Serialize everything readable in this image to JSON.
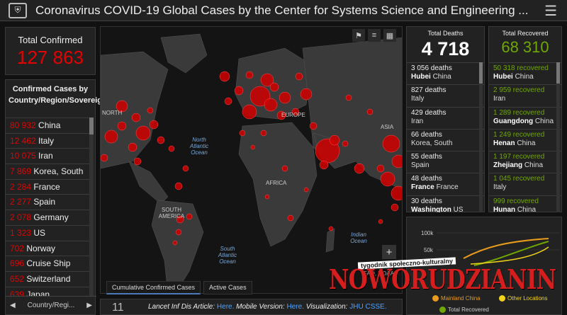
{
  "header": {
    "logo_icon": "shield-crest-icon",
    "title": "Coronavirus COVID-19 Global Cases by the Center for Systems Science and Engineering ..."
  },
  "total_confirmed": {
    "label": "Total Confirmed",
    "value": "127 863"
  },
  "country_panel": {
    "heading": "Confirmed Cases by Country/Region/Sovereignty",
    "rows": [
      {
        "count": "80 932",
        "name": "China"
      },
      {
        "count": "12 462",
        "name": "Italy"
      },
      {
        "count": "10 075",
        "name": "Iran"
      },
      {
        "count": "7 869",
        "name": "Korea, South"
      },
      {
        "count": "2 284",
        "name": "France"
      },
      {
        "count": "2 277",
        "name": "Spain"
      },
      {
        "count": "2 078",
        "name": "Germany"
      },
      {
        "count": "1 323",
        "name": "US"
      },
      {
        "count": "702",
        "name": "Norway"
      },
      {
        "count": "696",
        "name": "Cruise Ship"
      },
      {
        "count": "652",
        "name": "Switzerland"
      },
      {
        "count": "639",
        "name": "Japan"
      }
    ],
    "pager_label": "Country/Regi..."
  },
  "map": {
    "labels": {
      "north_america": "NORTH",
      "europe": "EUROPE",
      "asia": "ASIA",
      "africa": "AFRICA",
      "south_america": "SOUTH AMERICA"
    },
    "oceans": {
      "north_atlantic": "North Atlantic Ocean",
      "south_atlantic": "South Atlantic Ocean",
      "indian": "Indian Ocean"
    },
    "attribution": "FAO, NOAA",
    "tabs": [
      "Cumulative Confirmed Cases",
      "Active Cases"
    ]
  },
  "article_bar": {
    "number": "11",
    "lead": "Lancet Inf Dis Article:",
    "here1": "Here.",
    "mobile": "Mobile Version:",
    "here2": "Here.",
    "viz": "Visualization:",
    "viz_link": "JHU CSSE."
  },
  "deaths": {
    "label": "Total Deaths",
    "value": "4 718",
    "rows": [
      {
        "count": "3 056 deaths",
        "place": "Hubei",
        "region": "China"
      },
      {
        "count": "827 deaths",
        "place": "",
        "region": "Italy"
      },
      {
        "count": "429 deaths",
        "place": "",
        "region": "Iran"
      },
      {
        "count": "66 deaths",
        "place": "",
        "region": "Korea, South"
      },
      {
        "count": "55 deaths",
        "place": "",
        "region": "Spain"
      },
      {
        "count": "48 deaths",
        "place": "France",
        "region": "France"
      },
      {
        "count": "30 deaths",
        "place": "Washington",
        "region": "US"
      }
    ]
  },
  "recovered": {
    "label": "Total Recovered",
    "value": "68 310",
    "rows": [
      {
        "count": "50 318 recovered",
        "place": "Hubei",
        "region": "China"
      },
      {
        "count": "2 959 recovered",
        "place": "",
        "region": "Iran"
      },
      {
        "count": "1 289 recovered",
        "place": "Guangdong",
        "region": "China"
      },
      {
        "count": "1 249 recovered",
        "place": "Henan",
        "region": "China"
      },
      {
        "count": "1 197 recovered",
        "place": "Zhejiang",
        "region": "China"
      },
      {
        "count": "1 045 recovered",
        "place": "",
        "region": "Italy"
      },
      {
        "count": "999 recovered",
        "place": "Hunan",
        "region": "China"
      }
    ]
  },
  "trend_chart": {
    "y_ticks": [
      "100k",
      "50k"
    ],
    "legend": [
      "Mainland China",
      "Other Locations",
      "Total Recovered"
    ],
    "colors": {
      "mainland": "#e89b1c",
      "other": "#f2d31b",
      "recovered": "#70a800"
    }
  },
  "watermark": {
    "caption": "tygodnik społeczno-kulturalny",
    "brand": "NOWORUDZIANIN"
  },
  "colors": {
    "confirmed": "#e60000",
    "recovered": "#70a800",
    "bubble": "#d10000"
  }
}
